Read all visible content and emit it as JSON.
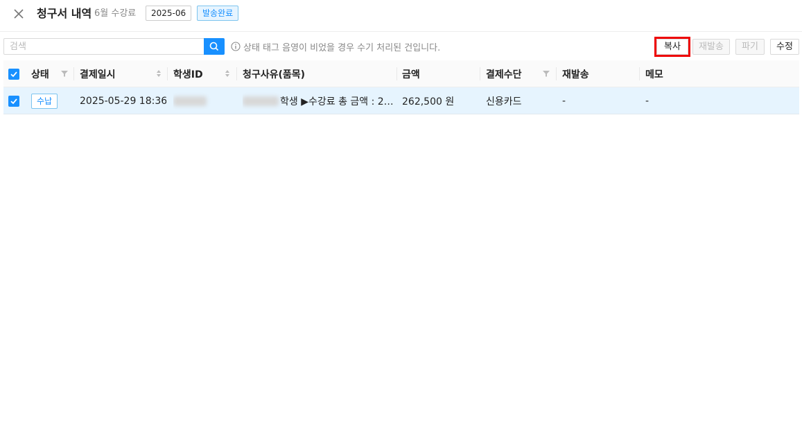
{
  "header": {
    "title": "청구서 내역",
    "subtitle": "6월 수강료",
    "month_tag": "2025-06",
    "status_tag": "발송완료"
  },
  "toolbar": {
    "search_placeholder": "검색",
    "info_text": "상태 태그 음영이 비었을 경우 수기 처리된 건입니다.",
    "copy_label": "복사",
    "resend_label": "재발송",
    "discard_label": "파기",
    "edit_label": "수정"
  },
  "table": {
    "columns": [
      "상태",
      "결제일시",
      "학생ID",
      "청구사유(품목)",
      "금액",
      "결제수단",
      "재발송",
      "메모"
    ],
    "rows": [
      {
        "status": "수납",
        "paid_at": "2025-05-29 18:36",
        "student_id": "",
        "reason": "학생 ▶수강료 총 금액 : 2…",
        "amount": "262,500 원",
        "method": "신용카드",
        "resend": "-",
        "memo": "-"
      }
    ]
  },
  "icons": {
    "close": "close-icon",
    "search": "search-icon",
    "info": "info-icon",
    "checkbox": "checkbox-checked-icon",
    "sort": "sort-icon",
    "filter": "filter-icon"
  },
  "colors": {
    "accent": "#1890ff",
    "selected_row": "#e6f4fe",
    "highlight_outline": "#ee0000"
  }
}
